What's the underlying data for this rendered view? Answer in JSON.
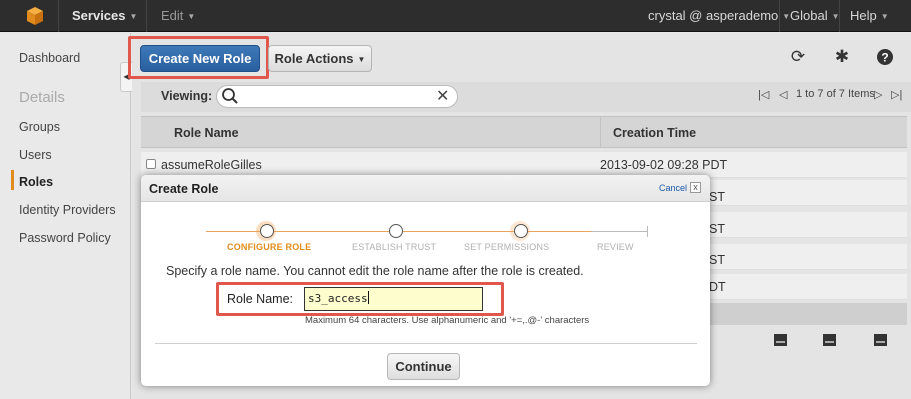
{
  "topbar": {
    "services": "Services",
    "edit": "Edit",
    "user": "crystal @ asperademo",
    "region": "Global",
    "help": "Help"
  },
  "sidebar": {
    "dashboard": "Dashboard",
    "section_heading": "Details",
    "items": [
      "Groups",
      "Users",
      "Roles",
      "Identity Providers",
      "Password Policy"
    ],
    "active_item": "Roles"
  },
  "toolbar": {
    "create_new_role": "Create New Role",
    "role_actions": "Role Actions"
  },
  "viewing": {
    "label": "Viewing:",
    "search_value": "",
    "pager_text": "1 to 7 of 7 Items"
  },
  "table": {
    "columns": [
      "Role Name",
      "Creation Time"
    ],
    "rows": [
      {
        "name": "assumeRoleGilles",
        "time": "2013-09-02 09:28 PDT"
      },
      {
        "name": "",
        "time": "ST"
      },
      {
        "name": "",
        "time": "ST"
      },
      {
        "name": "",
        "time": "ST"
      },
      {
        "name": "",
        "time": "DT"
      }
    ]
  },
  "modal": {
    "title": "Create Role",
    "cancel": "Cancel",
    "close_symbol": "x",
    "steps": [
      "CONFIGURE ROLE",
      "ESTABLISH TRUST",
      "SET PERMISSIONS",
      "REVIEW"
    ],
    "active_step": 0,
    "instructions": "Specify a role name. You cannot edit the role name after the role is created.",
    "role_name_label": "Role Name:",
    "role_name_value": "s3_access",
    "hint": "Maximum 64 characters. Use alphanumeric and '+=,.@-' characters",
    "continue": "Continue"
  },
  "colors": {
    "topbar": "#2d2d2d",
    "primary_button": "#2f68a8",
    "highlight": "#e2574c",
    "step_active": "#e08b1b",
    "step_inactive": "#b0b0b0"
  },
  "icons": {
    "logo": "aws-cube-icon",
    "refresh": "refresh-icon",
    "settings": "gear-icon",
    "help": "help-icon",
    "search": "search-icon",
    "clear": "close-icon"
  }
}
